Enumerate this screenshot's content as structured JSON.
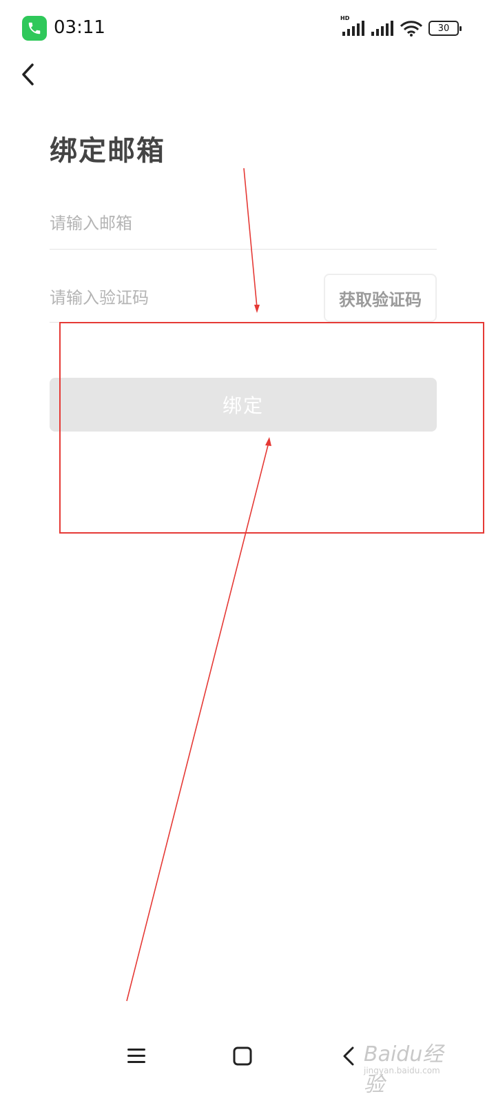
{
  "status_bar": {
    "time": "03:11",
    "hd_label": "HD",
    "battery_level": "30",
    "icons": [
      "phone-call-icon",
      "signal-icon",
      "signal-icon",
      "wifi-icon",
      "battery-icon"
    ]
  },
  "header": {
    "back_icon": "back-arrow-icon",
    "title": "绑定邮箱"
  },
  "form": {
    "email_placeholder": "请输入邮箱",
    "email_value": "",
    "code_placeholder": "请输入验证码",
    "code_value": "",
    "get_code_label": "获取验证码",
    "bind_label": "绑定"
  },
  "nav_bar": {
    "icons": [
      "menu-icon",
      "home-icon",
      "back-icon"
    ]
  },
  "watermark": {
    "text": "Baidu经验",
    "sub_text": "jingyan.baidu.com"
  },
  "colors": {
    "accent_green": "#2fc85a",
    "annotation_red": "#e53935",
    "button_disabled": "#e5e5e5"
  }
}
